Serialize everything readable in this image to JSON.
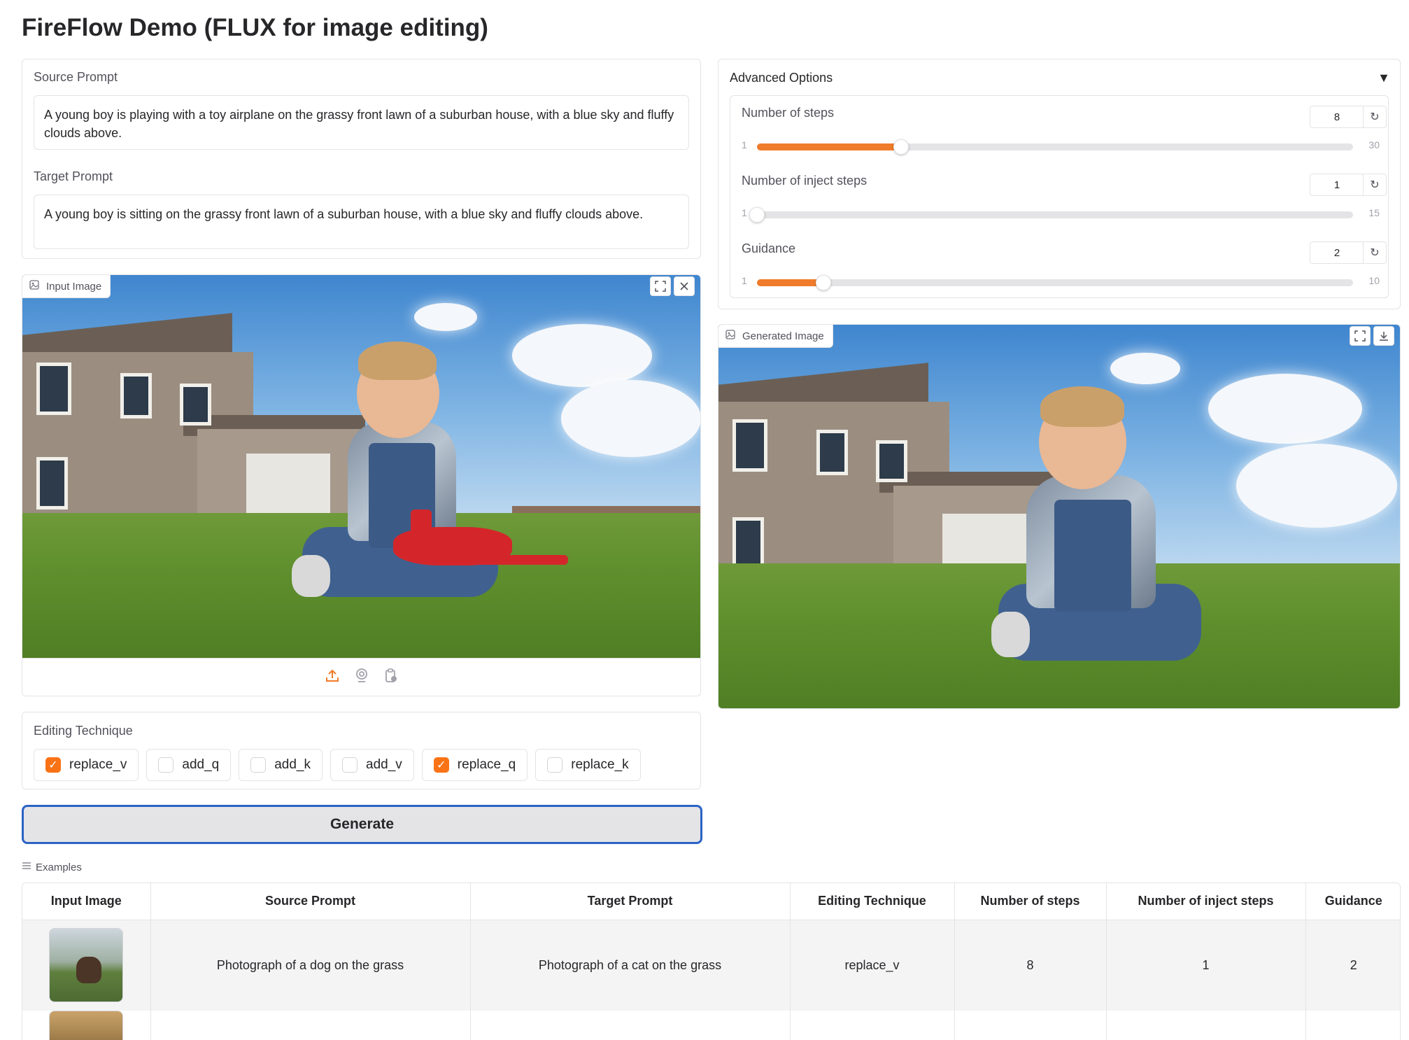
{
  "app": {
    "title": "FireFlow Demo (FLUX for image editing)"
  },
  "prompts": {
    "source_label": "Source Prompt",
    "source_value": "A young boy is playing with a toy airplane on the grassy front lawn of a suburban house, with a blue sky and fluffy clouds above.",
    "target_label": "Target Prompt",
    "target_value": "A young boy is sitting on the grassy front lawn of a suburban house, with a blue sky and fluffy clouds above."
  },
  "input_image": {
    "label": "Input Image",
    "icon": "image-icon"
  },
  "generated_image": {
    "label": "Generated Image",
    "icon": "image-icon"
  },
  "editing": {
    "label": "Editing Technique",
    "options": [
      {
        "label": "replace_v",
        "checked": true
      },
      {
        "label": "add_q",
        "checked": false
      },
      {
        "label": "add_k",
        "checked": false
      },
      {
        "label": "add_v",
        "checked": false
      },
      {
        "label": "replace_q",
        "checked": true
      },
      {
        "label": "replace_k",
        "checked": false
      }
    ]
  },
  "generate": {
    "label": "Generate"
  },
  "advanced": {
    "label": "Advanced Options",
    "toggle": "▼",
    "sliders": [
      {
        "label": "Number of steps",
        "value": "8",
        "min": "1",
        "max": "30",
        "fraction": 0.2414
      },
      {
        "label": "Number of inject steps",
        "value": "1",
        "min": "1",
        "max": "15",
        "fraction": 0.0
      },
      {
        "label": "Guidance",
        "value": "2",
        "min": "1",
        "max": "10",
        "fraction": 0.1111
      }
    ]
  },
  "examples": {
    "label": "Examples",
    "headers": [
      "Input Image",
      "Source Prompt",
      "Target Prompt",
      "Editing Technique",
      "Number of steps",
      "Number of inject steps",
      "Guidance"
    ],
    "rows": [
      {
        "source": "Photograph of a dog on the grass",
        "target": "Photograph of a cat on the grass",
        "technique": "replace_v",
        "steps": "8",
        "inject": "1",
        "guidance": "2"
      }
    ]
  },
  "colors": {
    "accent": "#f07b2a",
    "generate_border": "#2c63c5"
  }
}
